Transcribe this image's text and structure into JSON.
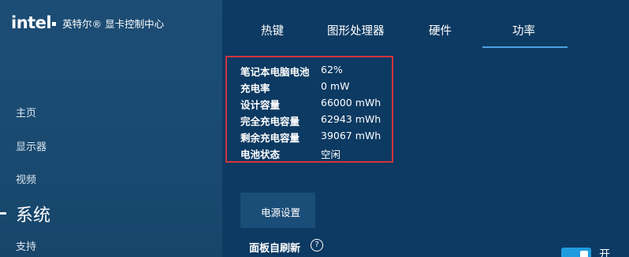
{
  "brand": {
    "logo_text": "intel",
    "app_title": "英特尔® 显卡控制中心"
  },
  "sidebar": {
    "items": [
      {
        "label": "主页",
        "active": false
      },
      {
        "label": "显示器",
        "active": false
      },
      {
        "label": "视频",
        "active": false
      },
      {
        "label": "系统",
        "active": true
      },
      {
        "label": "支持",
        "active": false
      }
    ]
  },
  "tabs": [
    {
      "label": "热键",
      "active": false
    },
    {
      "label": "图形处理器",
      "active": false
    },
    {
      "label": "硬件",
      "active": false
    },
    {
      "label": "功率",
      "active": true
    }
  ],
  "battery": {
    "rows": [
      {
        "label": "笔记本电脑电池",
        "value": "62%"
      },
      {
        "label": "充电率",
        "value": "0 mW"
      },
      {
        "label": "设计容量",
        "value": "66000 mWh"
      },
      {
        "label": "完全充电容量",
        "value": "62943 mWh"
      },
      {
        "label": "剩余充电容量",
        "value": "39067 mWh"
      },
      {
        "label": "电池状态",
        "value": "空闲"
      }
    ]
  },
  "power_settings": {
    "section_label": "电源设置",
    "panel_refresh_label": "面板自刷新",
    "help_glyph": "?",
    "toggle_state": "开"
  },
  "colors": {
    "background": "#0e3b63",
    "sidebar": "#1a4a70",
    "accent": "#4aa3df",
    "toggle_on": "#1f9be0",
    "highlight": "#d4333f"
  }
}
